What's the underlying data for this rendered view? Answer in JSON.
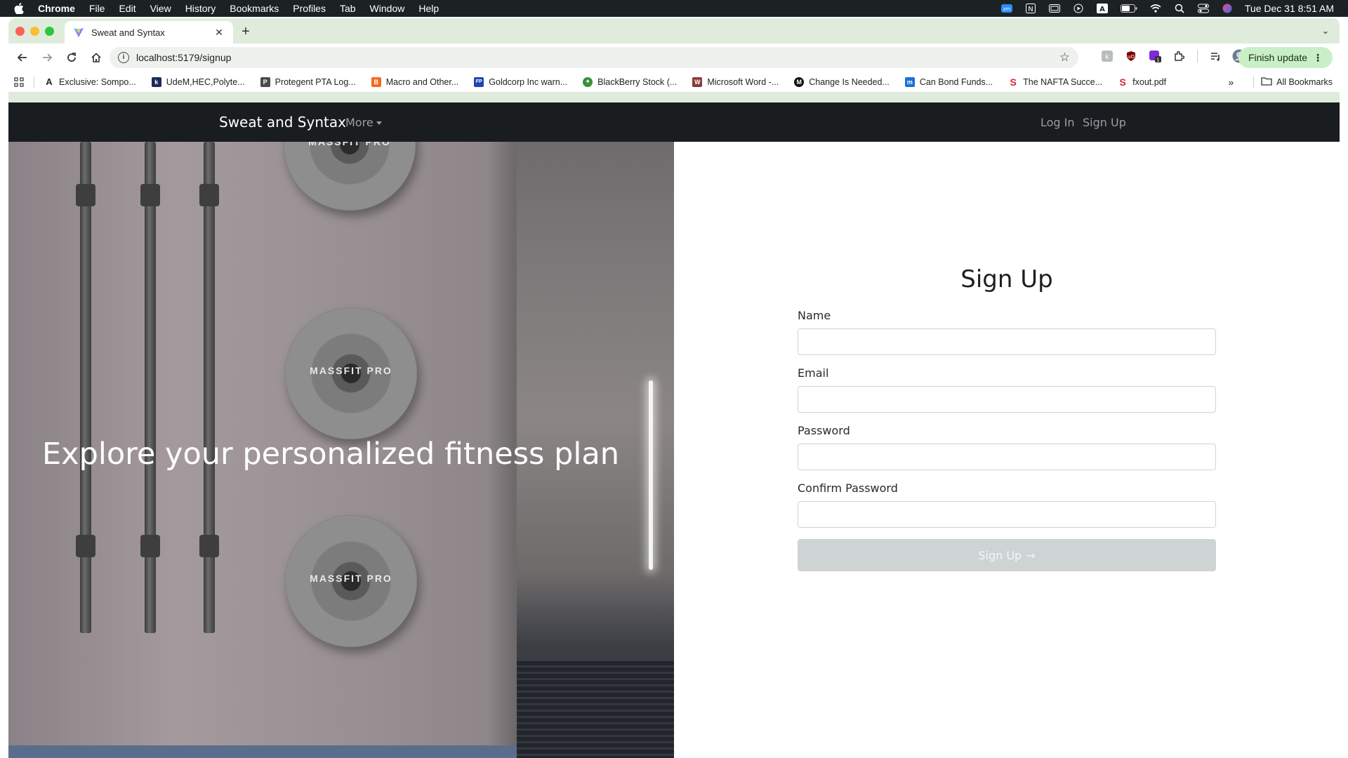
{
  "menubar": {
    "app_name": "Chrome",
    "items": [
      "File",
      "Edit",
      "View",
      "History",
      "Bookmarks",
      "Profiles",
      "Tab",
      "Window",
      "Help"
    ],
    "clock": "Tue Dec 31  8:51 AM",
    "status_icons": [
      "zoom-icon",
      "notion-icon",
      "window-icon",
      "play-icon",
      "keyboard-a-icon",
      "battery-icon",
      "wifi-icon",
      "search-icon",
      "control-center-icon",
      "siri-icon"
    ]
  },
  "browser": {
    "tab_title": "Sweat and Syntax",
    "url": "localhost:5179/signup",
    "finish_update": "Finish update",
    "bookmarks": [
      {
        "label": "Exclusive: Sompo...",
        "color": "#222222",
        "glyph": "A"
      },
      {
        "label": "UdeM,HEC,Polyte...",
        "color": "#1f2a5c",
        "glyph": "k"
      },
      {
        "label": "Protegent PTA Log...",
        "color": "#4b4b4b",
        "glyph": "P"
      },
      {
        "label": "Macro and Other...",
        "color": "#f26b21",
        "glyph": "B"
      },
      {
        "label": "Goldcorp Inc warn...",
        "color": "#2146b0",
        "glyph": "FP"
      },
      {
        "label": "BlackBerry Stock (...",
        "color": "#3a8f3a",
        "glyph": "*"
      },
      {
        "label": "Microsoft Word -...",
        "color": "#8a3b3b",
        "glyph": "W"
      },
      {
        "label": "Change Is Needed...",
        "color": "#111111",
        "glyph": "M"
      },
      {
        "label": "Can Bond Funds...",
        "color": "#1f6fd6",
        "glyph": "m"
      },
      {
        "label": "The NAFTA Succe...",
        "color": "#d9232a",
        "glyph": "S"
      },
      {
        "label": "fxout.pdf",
        "color": "#d9232a",
        "glyph": "S"
      }
    ],
    "all_bookmarks": "All Bookmarks"
  },
  "app": {
    "brand": "Sweat and Syntax",
    "more": "More",
    "login": "Log In",
    "signup": "Sign Up",
    "hero_text": "Explore your personalized fitness plan",
    "plate_text": "MASSFIT PRO"
  },
  "form": {
    "title": "Sign Up",
    "fields": [
      {
        "label": "Name",
        "value": ""
      },
      {
        "label": "Email",
        "value": ""
      },
      {
        "label": "Password",
        "value": ""
      },
      {
        "label": "Confirm Password",
        "value": ""
      }
    ],
    "submit_label": "Sign Up",
    "submit_arrow": "→"
  },
  "colors": {
    "menubar_bg": "#1c2223",
    "tabstrip_bg": "#dfecdc",
    "app_nav_bg": "#1a1d20",
    "submit_bg": "#ced4d4",
    "finish_update_bg": "#c9efc6"
  }
}
